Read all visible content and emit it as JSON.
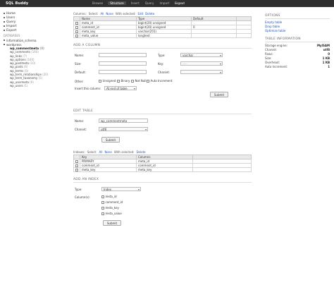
{
  "app": {
    "logo": "SQL Buddy"
  },
  "topnav": {
    "tabs": [
      "Browse",
      "Structure",
      "Insert",
      "Query",
      "Import",
      "Export"
    ],
    "active": "Structure",
    "logout": "Logout"
  },
  "sidebar": {
    "items": [
      "Home",
      "Users",
      "Query",
      "Import",
      "Export"
    ],
    "databases_heading": "DATABASES",
    "databases": [
      "information_schema",
      "wordpress"
    ],
    "tables": [
      {
        "name": "wp_commentmeta",
        "count": "(0)"
      },
      {
        "name": "wp_comments",
        "count": "(160)"
      },
      {
        "name": "wp_links",
        "count": "(7)"
      },
      {
        "name": "wp_options",
        "count": "(160)"
      },
      {
        "name": "wp_postmeta",
        "count": "(10)"
      },
      {
        "name": "wp_posts",
        "count": "(6)"
      },
      {
        "name": "wp_terms",
        "count": "(5)"
      },
      {
        "name": "wp_term_relationships",
        "count": "(20)"
      },
      {
        "name": "wp_term_taxonomy",
        "count": "(5)"
      },
      {
        "name": "wp_usermeta",
        "count": "(9)"
      },
      {
        "name": "wp_users",
        "count": "(1)"
      }
    ]
  },
  "columns_bar": {
    "label": "Columns:",
    "select": "Select:",
    "all": "All",
    "none": "None",
    "with_selected": "With selected:",
    "edit": "Edit",
    "delete": "Delete"
  },
  "columns_table": {
    "headers": [
      "Name",
      "Type",
      "Default"
    ],
    "rows": [
      {
        "name": "meta_id",
        "type": "bigint(20) unsigned",
        "default": ""
      },
      {
        "name": "comment_id",
        "type": "bigint(20) unsigned",
        "default": "0"
      },
      {
        "name": "meta_key",
        "type": "varchar(255)",
        "default": ""
      },
      {
        "name": "meta_value",
        "type": "longtext",
        "default": ""
      }
    ]
  },
  "add_column": {
    "title": "ADD A COLUMN",
    "name_label": "Name:",
    "type_label": "Type:",
    "type_value": "varchar",
    "size_label": "Size:",
    "key_label": "Key:",
    "key_value": "----",
    "default_label": "Default:",
    "charset_label": "Charset:",
    "other_label": "Other:",
    "options": [
      "Unsigned",
      "Binary",
      "Not Null",
      "Auto Increment"
    ],
    "insert_label": "Insert this column:",
    "insert_value": "At end of table",
    "submit": "Submit"
  },
  "edit_table": {
    "title": "EDIT TABLE",
    "name_label": "Name:",
    "name_value": "wp_commentmeta",
    "charset_label": "Charset:",
    "charset_value": "utf8",
    "submit": "Submit"
  },
  "indexes_bar": {
    "label": "Indexes:",
    "select": "Select:",
    "all": "All",
    "none": "None",
    "with_selected": "With selected:",
    "delete": "Delete"
  },
  "indexes_table": {
    "headers": [
      "Key",
      "Columns"
    ],
    "rows": [
      {
        "key": "PRIMARY",
        "columns": "meta_id"
      },
      {
        "key": "comment_id",
        "columns": "comment_id"
      },
      {
        "key": "meta_key",
        "columns": "meta_key"
      }
    ]
  },
  "add_index": {
    "title": "ADD AN INDEX",
    "type_label": "Type:",
    "type_value": "Index",
    "columns_label": "Column(s):",
    "columns": [
      "meta_id",
      "comment_id",
      "meta_key",
      "meta_value"
    ],
    "submit": "Submit"
  },
  "right_panel": {
    "options_title": "OPTIONS",
    "links": [
      "Empty table",
      "Drop table",
      "Optimize table"
    ],
    "info_title": "TABLE INFORMATION",
    "info": [
      {
        "label": "Storage engine:",
        "value": "MyISAM"
      },
      {
        "label": "Charset:",
        "value": "utf8"
      },
      {
        "label": "Rows:",
        "value": "0"
      },
      {
        "label": "Size:",
        "value": "1 KB"
      },
      {
        "label": "Overhead:",
        "value": "1 KB"
      },
      {
        "label": "Auto Increment:",
        "value": "1"
      }
    ]
  }
}
